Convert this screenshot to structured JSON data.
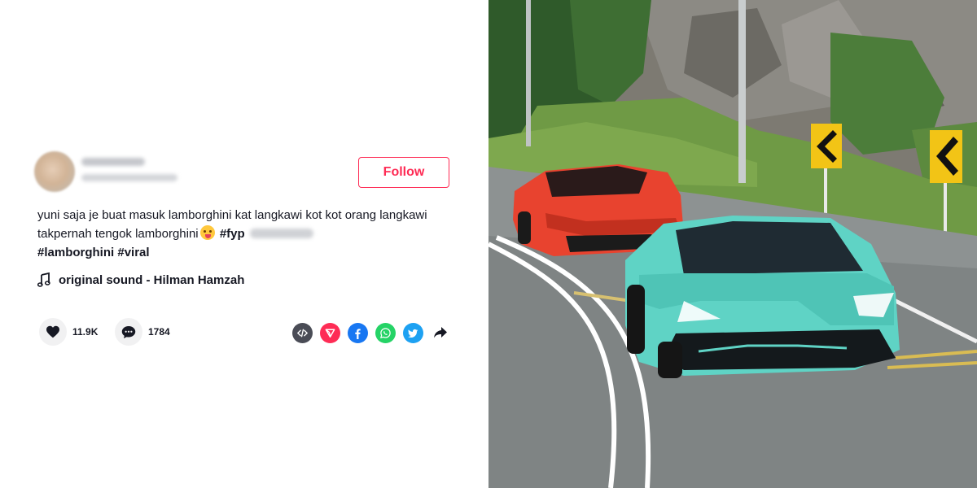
{
  "author": {
    "follow_label": "Follow"
  },
  "caption": {
    "text": "yuni saja je buat masuk lamborghini kat langkawi kot kot orang langkawi takpernah tengok lamborghini",
    "emoji": "squinting-face-with-tongue",
    "tags": [
      "#fyp",
      "#lamborghini",
      "#viral"
    ]
  },
  "music": {
    "icon": "music-note-icon",
    "label": "original sound - Hilman Hamzah"
  },
  "stats": {
    "likes": "11.9K",
    "comments": "1784"
  },
  "share": {
    "icons": [
      "embed-icon",
      "send-icon",
      "facebook-icon",
      "whatsapp-icon",
      "twitter-icon",
      "share-arrow-icon"
    ]
  },
  "colors": {
    "accent": "#fe2c55",
    "embed": "#4a4c56",
    "send": "#fe2c55",
    "facebook": "#1877f2",
    "whatsapp": "#25d366",
    "twitter": "#1da1f2"
  }
}
